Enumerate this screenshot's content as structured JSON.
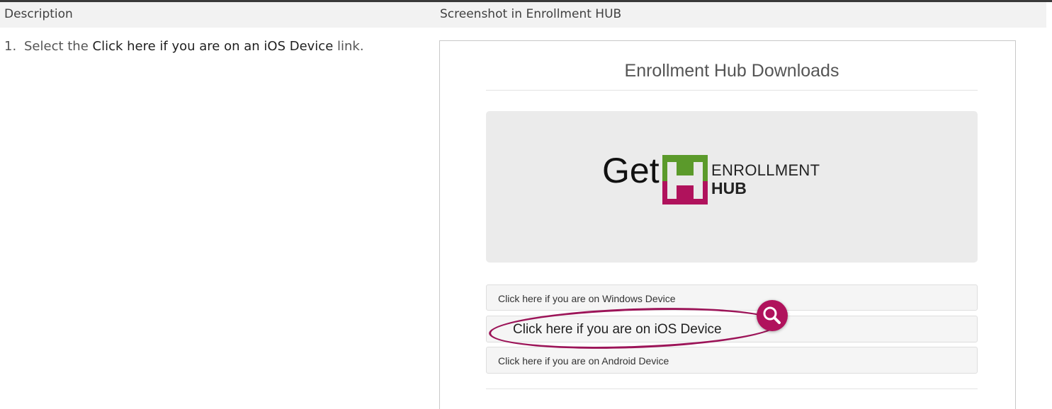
{
  "table": {
    "header_description": "Description",
    "header_screenshot": "Screenshot in Enrollment HUB"
  },
  "step": {
    "number": "1.",
    "prefix": "Select the ",
    "link_name": "Click here if you are on an iOS Device",
    "suffix": " link."
  },
  "screenshot": {
    "title": "Enrollment Hub Downloads",
    "hero": {
      "get_text": "Get",
      "logo_line1": "ENROLLMENT",
      "logo_line2": "HUB"
    },
    "links": {
      "windows": "Click here if you are on Windows Device",
      "ios": "Click here if you are on iOS Device",
      "android": "Click here if you are on Android Device"
    }
  },
  "colors": {
    "accent_magenta": "#b0125c",
    "logo_green": "#5b9a2b"
  }
}
